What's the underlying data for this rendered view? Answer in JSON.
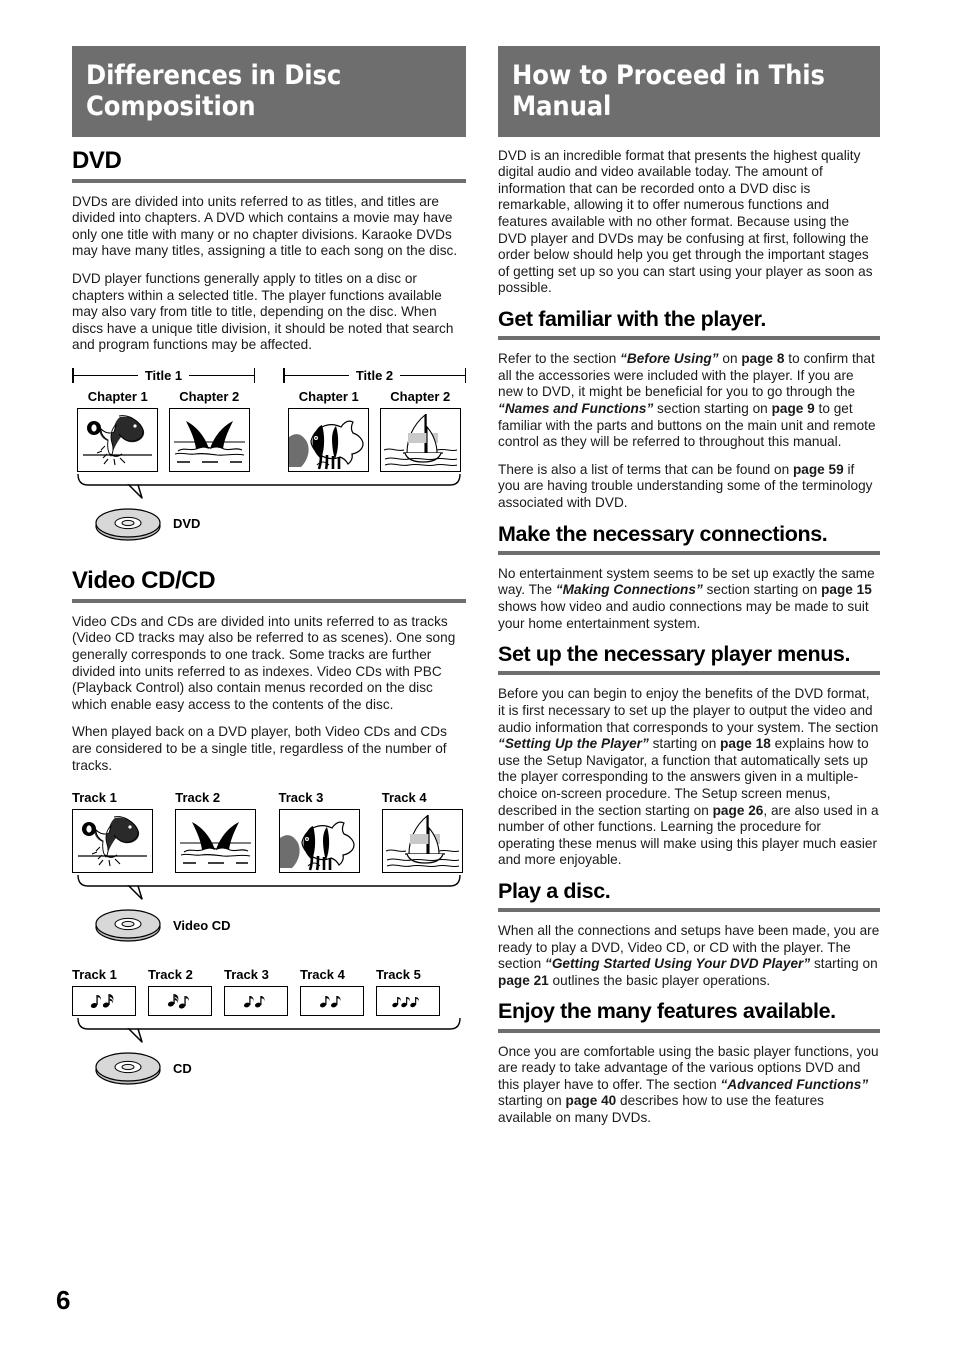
{
  "page_number": "6",
  "left_column": {
    "banner_title": "Differences in Disc Composition",
    "dvd_section": {
      "heading": "DVD",
      "paragraphs": [
        "DVDs are divided into units referred to as titles, and titles are divided into chapters. A DVD which contains a movie may have only one title with many or no chapter divisions. Karaoke DVDs may have many titles, assigning a title to each song on the disc.",
        "DVD player functions generally apply to titles on a disc or chapters within a selected title. The player functions available may also vary from title to title, depending on the disc. When discs have a unique title division, it should be noted that search and program functions may be affected."
      ],
      "diagram": {
        "titles": [
          {
            "label": "Title 1",
            "chapters": [
              {
                "label": "Chapter 1",
                "image": "dolphin-with-ball-illustration"
              },
              {
                "label": "Chapter 2",
                "image": "whale-tail-illustration"
              }
            ]
          },
          {
            "label": "Title 2",
            "chapters": [
              {
                "label": "Chapter 1",
                "image": "angelfish-illustration"
              },
              {
                "label": "Chapter 2",
                "image": "sailboat-illustration"
              }
            ]
          }
        ],
        "disc_label": "DVD",
        "disc_icon": "optical-disc-icon"
      }
    },
    "videocd_section": {
      "heading": "Video CD/CD",
      "paragraphs": [
        "Video CDs and CDs are divided into units referred to as tracks (Video CD tracks may also be referred to as scenes). One song generally corresponds to one track. Some tracks are further divided into units referred to as indexes. Video CDs with PBC (Playback Control) also contain menus recorded on the disc which enable easy access to the contents of the disc.",
        "When played back on a DVD player, both Video CDs and CDs are considered to be a single title, regardless of the number of tracks."
      ],
      "videocd_diagram": {
        "tracks": [
          {
            "label": "Track 1",
            "image": "dolphin-with-ball-illustration"
          },
          {
            "label": "Track 2",
            "image": "whale-tail-illustration"
          },
          {
            "label": "Track 3",
            "image": "angelfish-illustration"
          },
          {
            "label": "Track 4",
            "image": "sailboat-illustration"
          }
        ],
        "disc_label": "Video CD",
        "disc_icon": "optical-disc-icon"
      },
      "cd_diagram": {
        "tracks": [
          {
            "label": "Track 1",
            "image": "music-notes-icon"
          },
          {
            "label": "Track 2",
            "image": "music-notes-icon"
          },
          {
            "label": "Track 3",
            "image": "music-notes-icon"
          },
          {
            "label": "Track 4",
            "image": "music-notes-icon"
          },
          {
            "label": "Track 5",
            "image": "music-notes-icon"
          }
        ],
        "disc_label": "CD",
        "disc_icon": "optical-disc-icon"
      }
    }
  },
  "right_column": {
    "banner_title": "How to Proceed in This Manual",
    "intro": "DVD is an incredible format that presents the highest quality digital audio and video available today. The amount of information that can be recorded onto a DVD disc is remarkable, allowing it to offer numerous functions and features available with no other format. Because using the DVD player and DVDs may be confusing at first, following the order below should help you get through the important stages of getting set up so you can start using your player as soon as possible.",
    "steps": [
      {
        "heading": "Get familiar with the player.",
        "paragraphs": [
          {
            "runs": [
              {
                "text": "Refer to the section  ",
                "style": "normal"
              },
              {
                "text": "“Before Using”",
                "style": "italic-bold"
              },
              {
                "text": " on ",
                "style": "normal"
              },
              {
                "text": "page 8",
                "style": "bold"
              },
              {
                "text": " to confirm that all the accessories were included with the player. If you are new to DVD, it might be beneficial for you to go through the ",
                "style": "normal"
              },
              {
                "text": "“Names and Functions”",
                "style": "italic-bold"
              },
              {
                "text": " section starting on ",
                "style": "normal"
              },
              {
                "text": "page 9",
                "style": "bold"
              },
              {
                "text": " to get familiar with the parts and buttons on the main unit and remote control as they will be referred to throughout this manual.",
                "style": "normal"
              }
            ]
          },
          {
            "runs": [
              {
                "text": "There is also a list of terms that can be found on ",
                "style": "normal"
              },
              {
                "text": "page 59",
                "style": "bold"
              },
              {
                "text": " if you are having trouble understanding some of the terminology associated with DVD.",
                "style": "normal"
              }
            ]
          }
        ]
      },
      {
        "heading": "Make the necessary connections.",
        "paragraphs": [
          {
            "runs": [
              {
                "text": "No entertainment system seems to be set up exactly the same way. The ",
                "style": "normal"
              },
              {
                "text": "“Making Connections”",
                "style": "italic-bold"
              },
              {
                "text": " section starting on ",
                "style": "normal"
              },
              {
                "text": "page 15",
                "style": "bold"
              },
              {
                "text": " shows how video and audio connections may be made to suit your home entertainment system.",
                "style": "normal"
              }
            ]
          }
        ]
      },
      {
        "heading": "Set up the necessary player menus.",
        "paragraphs": [
          {
            "runs": [
              {
                "text": "Before you can begin to enjoy the benefits of the DVD format, it is first necessary to set up the player to output the video and audio information that corresponds to your system. The section ",
                "style": "normal"
              },
              {
                "text": "“Setting Up the Player”",
                "style": "italic-bold"
              },
              {
                "text": " starting on ",
                "style": "normal"
              },
              {
                "text": "page 18",
                "style": "bold"
              },
              {
                "text": " explains how to use the Setup Navigator, a function that automatically sets up the player corresponding to the answers given in a multiple-choice on-screen procedure. The Setup screen menus, described in the section starting on ",
                "style": "normal"
              },
              {
                "text": "page 26",
                "style": "bold"
              },
              {
                "text": ", are also used in a number of other functions. Learning the procedure for operating these menus will make using this player much easier and more enjoyable.",
                "style": "normal"
              }
            ]
          }
        ]
      },
      {
        "heading": "Play a disc.",
        "paragraphs": [
          {
            "runs": [
              {
                "text": "When all the connections and setups have been made, you are ready to play a DVD, Video CD, or CD with the player. The section  ",
                "style": "normal"
              },
              {
                "text": "“Getting Started Using Your DVD Player”",
                "style": "italic-bold"
              },
              {
                "text": " starting on ",
                "style": "normal"
              },
              {
                "text": "page 21",
                "style": "bold"
              },
              {
                "text": " outlines the basic player operations.",
                "style": "normal"
              }
            ]
          }
        ]
      },
      {
        "heading": "Enjoy the many features available.",
        "paragraphs": [
          {
            "runs": [
              {
                "text": "Once you are comfortable using the basic player functions, you are ready to take advantage of the various options DVD and this player have to offer. The section ",
                "style": "normal"
              },
              {
                "text": "“Advanced Functions”",
                "style": "italic-bold"
              },
              {
                "text": " starting on ",
                "style": "normal"
              },
              {
                "text": "page 40",
                "style": "bold"
              },
              {
                "text": " describes how to use the features available on many DVDs.",
                "style": "normal"
              }
            ]
          }
        ]
      }
    ]
  },
  "colors": {
    "banner_bg": "#6e6e6e",
    "rule": "#6e6e6e",
    "text": "#1a1a1a",
    "disc_fill": "#d0d0d0"
  }
}
